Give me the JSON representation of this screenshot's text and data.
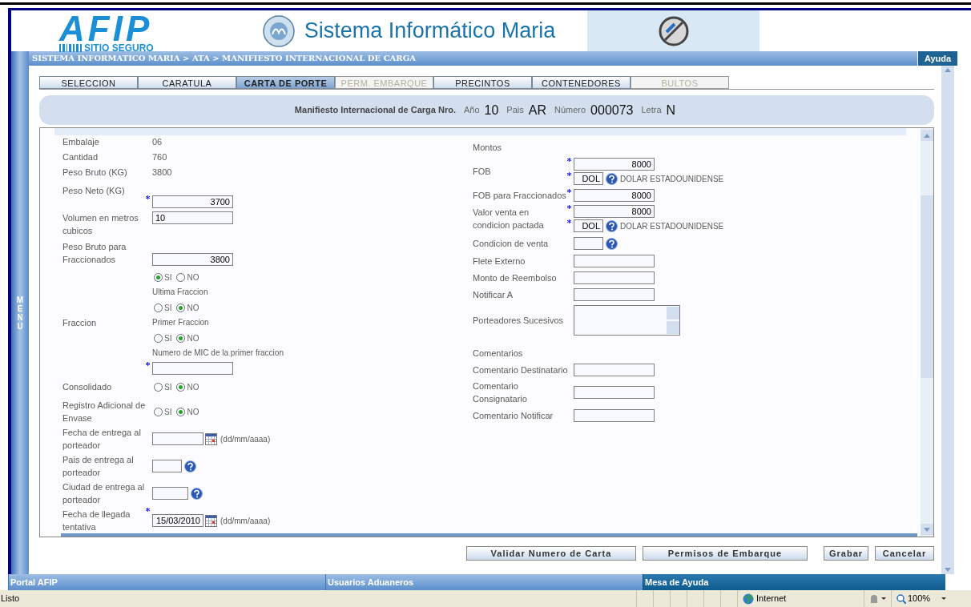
{
  "header": {
    "logo_text": "AFIP",
    "logo_subtitle": "SITIO SEGURO",
    "title": "Sistema Informático Maria"
  },
  "breadcrumb": "SISTEMA INFORMATICO MARIA > ATA > MANIFIESTO INTERNACIONAL DE CARGA",
  "help_button": "Ayuda",
  "side_menu": "MENU",
  "tabs": [
    {
      "label": "SELECCION",
      "selected": false,
      "disabled": false
    },
    {
      "label": "CARATULA",
      "selected": false,
      "disabled": false
    },
    {
      "label": "CARTA DE PORTE",
      "selected": true,
      "disabled": false
    },
    {
      "label": "PERM. EMBARQUE",
      "selected": false,
      "disabled": true
    },
    {
      "label": "PRECINTOS",
      "selected": false,
      "disabled": false
    },
    {
      "label": "CONTENEDORES",
      "selected": false,
      "disabled": false
    },
    {
      "label": "BULTOS",
      "selected": false,
      "disabled": true
    }
  ],
  "manifest": {
    "label": "Manifiesto Internacional de Carga Nro.",
    "fields": [
      {
        "label": "Año",
        "value": "10"
      },
      {
        "label": "Pais",
        "value": "AR"
      },
      {
        "label": "Número",
        "value": "000073"
      },
      {
        "label": "Letra",
        "value": "N"
      }
    ]
  },
  "left_fields": [
    {
      "kind": "static",
      "label": "Embalaje",
      "value": "06"
    },
    {
      "kind": "static",
      "label": "Cantidad",
      "value": "760"
    },
    {
      "kind": "static",
      "label": "Peso Bruto (KG)",
      "value": "3800"
    },
    {
      "kind": "input",
      "label": "Peso Neto (KG)",
      "value": "3700",
      "required": true
    },
    {
      "kind": "text_input",
      "label": "Volumen en metros cubicos",
      "value": "10",
      "required": false
    },
    {
      "kind": "input",
      "label": "Peso Bruto para Fraccionados",
      "value": "3800",
      "required": false
    },
    {
      "kind": "fraccion",
      "label": "Fraccion",
      "groups": [
        {
          "options": [
            {
              "label": "SI",
              "selected": true
            },
            {
              "label": "NO",
              "selected": false
            }
          ]
        },
        {
          "caption": "Ultima Fraccion",
          "options": [
            {
              "label": "SI",
              "selected": false
            },
            {
              "label": "NO",
              "selected": true
            }
          ]
        },
        {
          "caption": "Primer Fraccion",
          "options": [
            {
              "label": "SI",
              "selected": false
            },
            {
              "label": "NO",
              "selected": true
            }
          ]
        }
      ],
      "mic": {
        "caption": "Numero de MIC de la primer fraccion",
        "required": true
      }
    },
    {
      "kind": "radio",
      "label": "Consolidado",
      "options": [
        {
          "label": "SI",
          "selected": false
        },
        {
          "label": "NO",
          "selected": true
        }
      ]
    },
    {
      "kind": "radio",
      "label": "Registro Adicional de Envase",
      "options": [
        {
          "label": "SI",
          "selected": false
        },
        {
          "label": "NO",
          "selected": true
        }
      ]
    },
    {
      "kind": "date",
      "label": "Fecha de entrega al porteador",
      "required": false,
      "hint": "(dd/mm/aaaa)"
    },
    {
      "kind": "code_help",
      "label": "Pais de entrega al porteador"
    },
    {
      "kind": "code_help",
      "label": "Ciudad de entrega al porteador"
    },
    {
      "kind": "date",
      "label": "Fecha de llegada tentativa",
      "value": "15/03/2010",
      "required": true,
      "hint": "(dd/mm/aaaa)"
    }
  ],
  "right_fields": [
    {
      "kind": "heading",
      "label": "Montos"
    },
    {
      "kind": "amount_currency",
      "label": "FOB",
      "amount": "8000",
      "currency": "DOL",
      "currency_name": "DOLAR ESTADOUNIDENSE"
    },
    {
      "kind": "input",
      "label": "FOB para Fraccionados",
      "value": "8000",
      "required": true
    },
    {
      "kind": "amount_currency",
      "label": "Valor venta en condicion pactada",
      "amount": "8000",
      "currency": "DOL",
      "currency_name": "DOLAR ESTADOUNIDENSE"
    },
    {
      "kind": "code_help",
      "label": "Condicion de venta"
    },
    {
      "kind": "input",
      "label": "Flete Externo",
      "required": false
    },
    {
      "kind": "input",
      "label": "Monto de Reembolso",
      "required": false
    },
    {
      "kind": "input",
      "label": "Notificar A",
      "required": false
    },
    {
      "kind": "textarea",
      "label": "Porteadores Sucesivos"
    },
    {
      "kind": "heading",
      "label": "Comentarios"
    },
    {
      "kind": "input",
      "label": "Comentario Destinatario",
      "required": false
    },
    {
      "kind": "input",
      "label": "Comentario Consignatario",
      "required": false
    },
    {
      "kind": "input",
      "label": "Comentario Notificar",
      "required": false
    }
  ],
  "buttons": [
    "Validar Numero de Carta",
    "Permisos de Embarque",
    "Grabar",
    "Cancelar"
  ],
  "footer_links": [
    "Portal AFIP",
    "Usuarios Aduaneros",
    "Mesa de Ayuda"
  ],
  "status_bar": {
    "text": "Listo",
    "zone": "Internet",
    "zoom": "100%"
  }
}
